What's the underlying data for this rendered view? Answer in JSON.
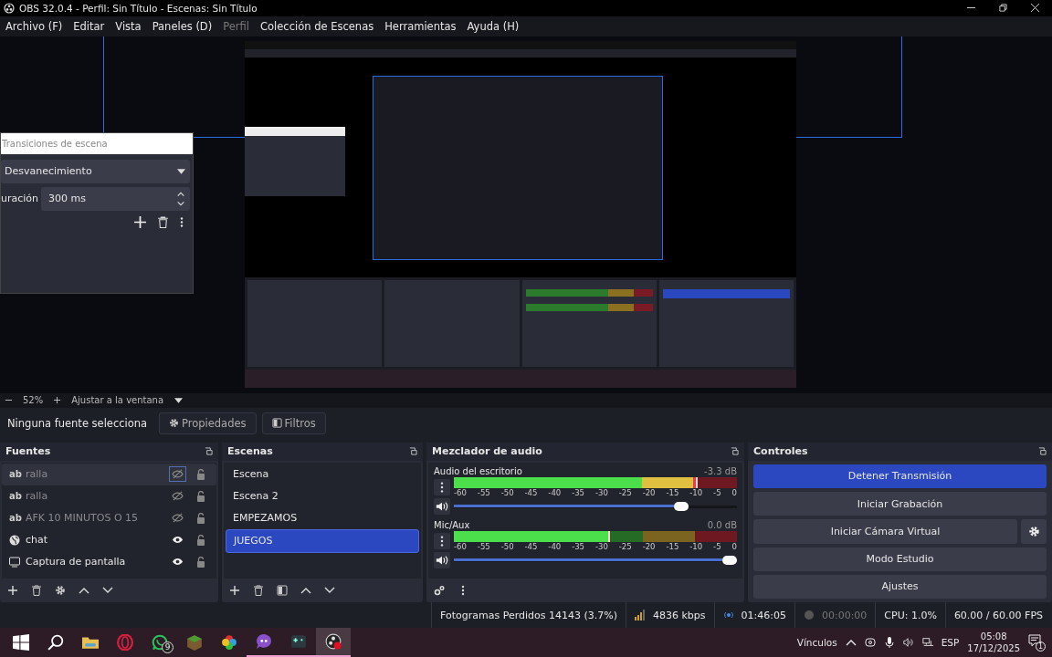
{
  "window": {
    "title": "OBS 32.0.4 - Perfil: Sin Título - Escenas: Sin Título"
  },
  "menu": [
    {
      "label": "Archivo (F)",
      "disabled": false
    },
    {
      "label": "Editar",
      "disabled": false
    },
    {
      "label": "Vista",
      "disabled": false
    },
    {
      "label": "Paneles (D)",
      "disabled": false
    },
    {
      "label": "Perfil",
      "disabled": true
    },
    {
      "label": "Colección de Escenas",
      "disabled": false
    },
    {
      "label": "Herramientas",
      "disabled": false
    },
    {
      "label": "Ayuda (H)",
      "disabled": false
    }
  ],
  "transitions_panel": {
    "title": "Transiciones de escena",
    "transition": "Desvanecimiento",
    "duration_label": "uración",
    "duration": "300 ms"
  },
  "zoom_bar": {
    "zoom": "52%",
    "fit": "Ajustar a la ventana"
  },
  "source_toolbar": {
    "status": "Ninguna fuente selecciona",
    "properties": "Propiedades",
    "filters": "Filtros"
  },
  "sources": {
    "title": "Fuentes",
    "items": [
      {
        "kind": "text",
        "icon": "ab",
        "name": "ralla",
        "visible": false,
        "selected": true
      },
      {
        "kind": "text",
        "icon": "ab",
        "name": "ralla",
        "visible": false,
        "selected": false
      },
      {
        "kind": "text",
        "icon": "ab",
        "name": "AFK 10 MINUTOS O 15",
        "visible": false,
        "selected": false
      },
      {
        "kind": "browser",
        "name": "chat",
        "visible": true,
        "selected": false
      },
      {
        "kind": "display",
        "name": "Captura de pantalla",
        "visible": true,
        "selected": false
      }
    ]
  },
  "scenes": {
    "title": "Escenas",
    "items": [
      {
        "name": "Escena",
        "selected": false
      },
      {
        "name": "Escena 2",
        "selected": false
      },
      {
        "name": "EMPEZAMOS",
        "selected": false
      },
      {
        "name": "JUEGOS",
        "selected": true
      }
    ]
  },
  "mixer": {
    "title": "Mezclador de audio",
    "channels": [
      {
        "name": "Audio del escritorio",
        "reading": "-3.3 dB",
        "meter": {
          "level": 0.86
        },
        "volume": {
          "level": 0.82
        },
        "ticks": [
          "-60",
          "-55",
          "-50",
          "-45",
          "-40",
          "-35",
          "-30",
          "-25",
          "-20",
          "-15",
          "-10",
          "-5",
          "0"
        ]
      },
      {
        "name": "Mic/Aux",
        "reading": "0.0 dB",
        "meter": {
          "level": 0.55
        },
        "volume": {
          "level": 1
        },
        "ticks": [
          "-60",
          "-55",
          "-50",
          "-45",
          "-40",
          "-35",
          "-30",
          "-25",
          "-20",
          "-15",
          "-10",
          "-5",
          "0"
        ]
      }
    ]
  },
  "controls": {
    "title": "Controles",
    "buttons": [
      {
        "label": "Detener Transmisión",
        "active": true,
        "settings": false
      },
      {
        "label": "Iniciar Grabación",
        "active": false,
        "settings": false
      },
      {
        "label": "Iniciar Cámara Virtual",
        "active": false,
        "settings": true
      },
      {
        "label": "Modo Estudio",
        "active": false,
        "settings": false
      },
      {
        "label": "Ajustes",
        "active": false,
        "settings": false
      }
    ]
  },
  "status_bar": {
    "dropped": "Fotogramas Perdidos 14143 (3.7%)",
    "bitrate": "4836 kbps",
    "stream_time": "01:46:05",
    "record_time": "00:00:00",
    "cpu": "CPU: 1.0%",
    "fps": "60.00 / 60.00 FPS"
  },
  "taskbar": {
    "apps": [
      {
        "kind": "start",
        "running": false,
        "active": false
      },
      {
        "kind": "search",
        "running": false,
        "active": false
      },
      {
        "kind": "folder",
        "running": false,
        "active": false
      },
      {
        "kind": "opera",
        "running": false,
        "active": false
      },
      {
        "kind": "whatsapp",
        "badge": "9",
        "running": false,
        "active": false
      },
      {
        "kind": "cube",
        "running": false,
        "active": false
      },
      {
        "kind": "colorwheel",
        "running": false,
        "active": false
      },
      {
        "kind": "chat",
        "running": true,
        "active": false
      },
      {
        "kind": "gamepad",
        "running": true,
        "active": false
      },
      {
        "kind": "obs",
        "running": true,
        "active": true
      }
    ],
    "tray": {
      "links": "Vínculos",
      "language": "ESP",
      "time": "05:08",
      "date": "17/12/2025",
      "notifications": "1"
    }
  }
}
